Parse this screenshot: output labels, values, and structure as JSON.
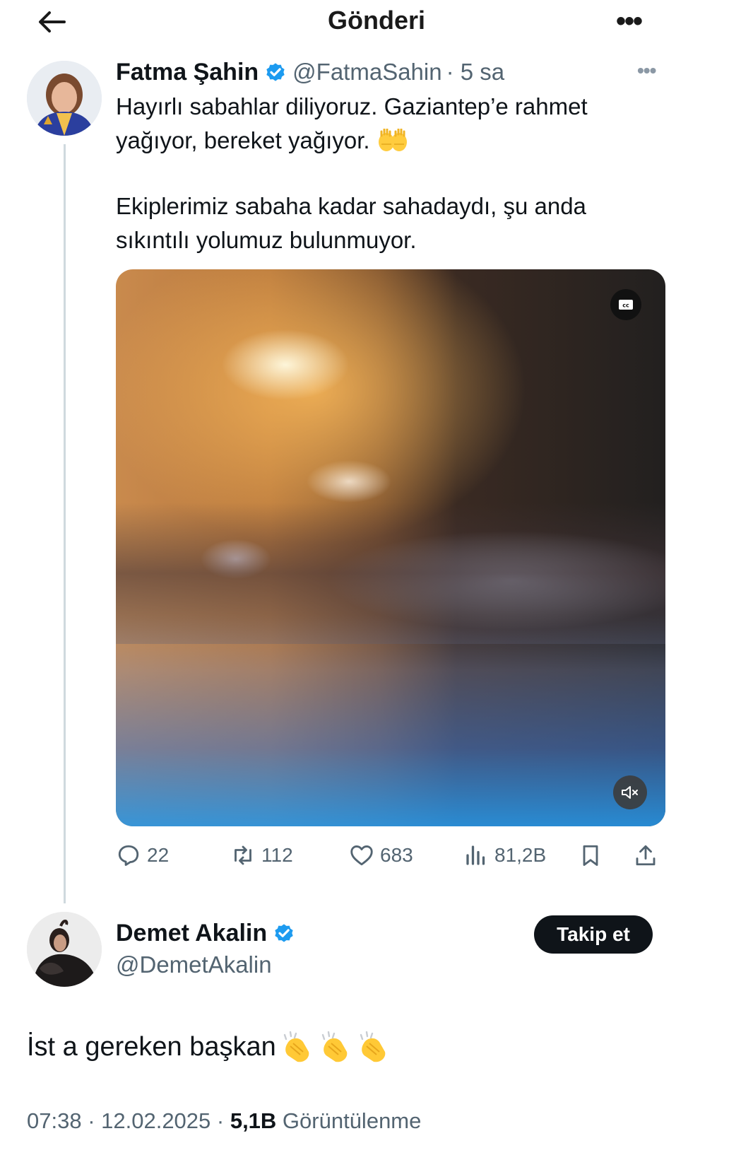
{
  "header": {
    "title": "Gönderi",
    "back_icon": "arrow-left-icon",
    "more_label": "•••"
  },
  "parent_tweet": {
    "name": "Fatma Şahin",
    "handle": "@FatmaSahin",
    "time": "· 5 sa",
    "more_label": "•••",
    "text_line1": "Hayırlı sabahlar diliyoruz. Gaziantep’e rahmet",
    "text_line2": "yağıyor, bereket yağıyor.",
    "text_line3": "Ekiplerimiz sabaha kadar sahadaydı, şu anda",
    "text_line4": "sıkıntılı yolumuz bulunmuyor.",
    "emoji": "raised-hands-emoji",
    "stats": {
      "replies": "22",
      "retweets": "112",
      "likes": "683",
      "views": "81,2B"
    },
    "accent_color": "#1d9bf0"
  },
  "reply_tweet": {
    "name": "Demet Akalin",
    "handle": "@DemetAkalin",
    "follow_label": "Takip et",
    "text": "İst a gereken  başkan",
    "emoji": "clapping-hands-emoji",
    "timestamp": "07:38 · 12.02.2025 · ",
    "views_count": "5,1B",
    "views_label": " Görüntülenme"
  }
}
